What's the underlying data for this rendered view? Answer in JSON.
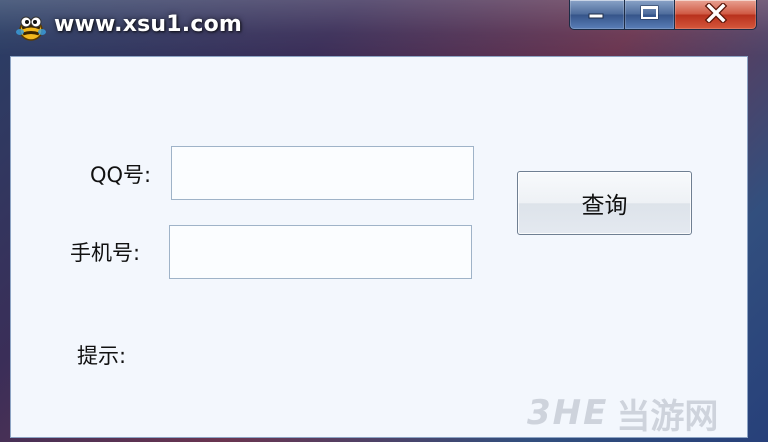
{
  "window": {
    "title": "www.xsu1.com",
    "app_icon": "bee-mascot-icon",
    "caption_buttons": {
      "minimize_icon": "minimize-icon",
      "maximize_icon": "maximize-icon",
      "close_icon": "close-icon"
    }
  },
  "form": {
    "qq_label": "QQ号:",
    "qq_value": "",
    "phone_label": "手机号:",
    "phone_value": "",
    "query_button": "查询",
    "tip_label": "提示:"
  },
  "watermark": {
    "brand": "3HE",
    "site": "当游网"
  },
  "colors": {
    "client_background": "#f3f7fd",
    "close_button": "#c8412a",
    "caption_button": "#4f6d9c"
  }
}
